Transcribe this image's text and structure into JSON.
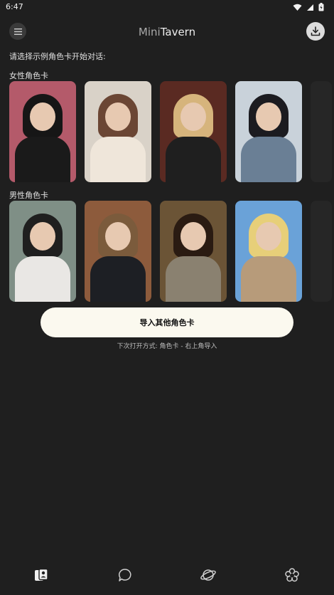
{
  "status": {
    "time": "6:47"
  },
  "app": {
    "title_part1": "Mini",
    "title_part2": "Tavern"
  },
  "prompt": "请选择示例角色卡开始对话:",
  "female_section": {
    "label": "女性角色卡",
    "cards": [
      {
        "name": "female-card-1",
        "bg": "#b45a6a",
        "hair": "#161616",
        "body": "#1a1a1a"
      },
      {
        "name": "female-card-2",
        "bg": "#d9d2c8",
        "hair": "#6b4634",
        "body": "#efe6da"
      },
      {
        "name": "female-card-3",
        "bg": "#5a2a22",
        "hair": "#d6b47c",
        "body": "#1f1f1f"
      },
      {
        "name": "female-card-4",
        "bg": "#c9d2da",
        "hair": "#1b1b20",
        "body": "#6a7f95"
      }
    ]
  },
  "male_section": {
    "label": "男性角色卡",
    "cards": [
      {
        "name": "male-card-1",
        "bg": "#7f8f86",
        "hair": "#1f1f1f",
        "body": "#e9e7e4"
      },
      {
        "name": "male-card-2",
        "bg": "#8d5b3c",
        "hair": "#7b5b3c",
        "body": "#1d1f24"
      },
      {
        "name": "male-card-3",
        "bg": "#6b5436",
        "hair": "#2a1b12",
        "body": "#8a8170"
      },
      {
        "name": "male-card-4",
        "bg": "#6aa2d8",
        "hair": "#e7cf79",
        "body": "#b79b7a"
      }
    ]
  },
  "import_button": {
    "label": "导入其他角色卡"
  },
  "hint": "下次打开方式: 角色卡 - 右上角导入",
  "colors": {
    "background": "#1f1f1f",
    "button_bg": "#fbf9ef"
  },
  "bottom_nav": [
    "cards-icon",
    "chat-icon",
    "planet-icon",
    "flower-icon"
  ]
}
